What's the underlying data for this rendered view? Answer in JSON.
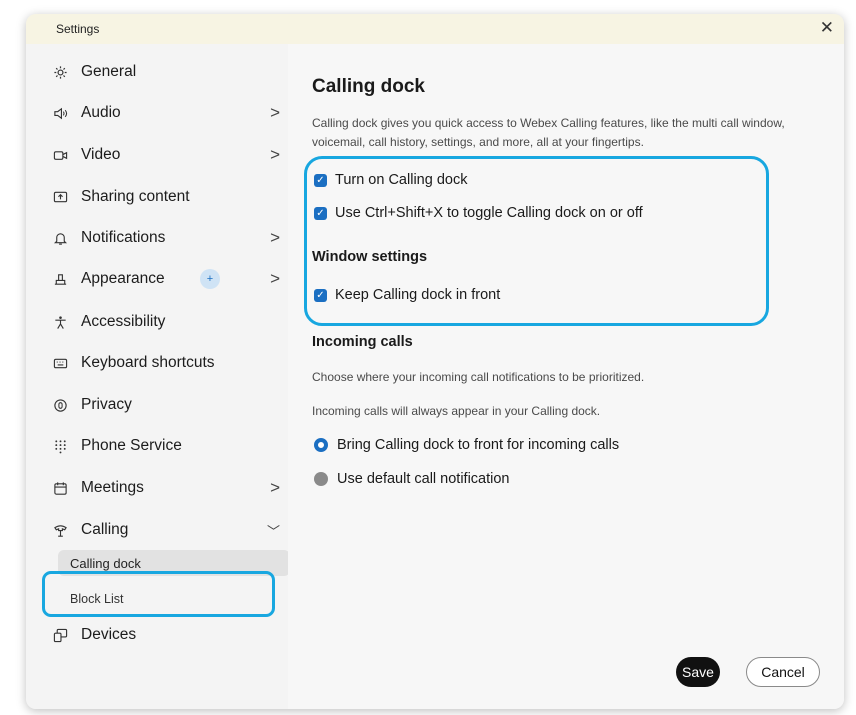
{
  "window": {
    "title": "Settings",
    "close_label": "✕"
  },
  "sidebar": {
    "items": [
      {
        "label": "General",
        "icon": "gear-icon"
      },
      {
        "label": "Audio",
        "icon": "speaker-icon",
        "chevron": ">"
      },
      {
        "label": "Video",
        "icon": "camera-icon",
        "chevron": ">"
      },
      {
        "label": "Sharing content",
        "icon": "share-screen-icon"
      },
      {
        "label": "Notifications",
        "icon": "bell-icon",
        "chevron": ">"
      },
      {
        "label": "Appearance",
        "icon": "paint-icon",
        "chevron": ">",
        "badge": "+"
      },
      {
        "label": "Accessibility",
        "icon": "accessibility-icon"
      },
      {
        "label": "Keyboard shortcuts",
        "icon": "keyboard-icon"
      },
      {
        "label": "Privacy",
        "icon": "privacy-icon"
      },
      {
        "label": "Phone Service",
        "icon": "dialpad-icon"
      },
      {
        "label": "Meetings",
        "icon": "calendar-icon",
        "chevron": ">"
      },
      {
        "label": "Calling",
        "icon": "phone-icon",
        "chevron": "﹀"
      },
      {
        "label": "Devices",
        "icon": "devices-icon"
      }
    ],
    "sub_items": [
      {
        "label": "Calling dock",
        "selected": true
      },
      {
        "label": "Block List",
        "selected": false
      }
    ]
  },
  "main": {
    "title": "Calling dock",
    "description": "Calling dock gives you quick access to Webex Calling features, like the multi call window, voicemail, call history, settings, and more, all at your fingertips.",
    "checkboxes": [
      {
        "label": "Turn on Calling dock",
        "checked": true
      },
      {
        "label": "Use Ctrl+Shift+X to toggle Calling dock on or off",
        "checked": true
      }
    ],
    "window_settings": {
      "heading": "Window settings",
      "checkbox": {
        "label": "Keep Calling dock in front",
        "checked": true
      }
    },
    "incoming_calls": {
      "heading": "Incoming calls",
      "text1": "Choose where your incoming call notifications to be prioritized.",
      "text2": "Incoming calls will always appear in your Calling dock.",
      "options": [
        {
          "label": "Bring Calling dock to front for incoming calls",
          "selected": true
        },
        {
          "label": "Use default call notification",
          "selected": false
        }
      ]
    }
  },
  "footer": {
    "save_label": "Save",
    "cancel_label": "Cancel"
  },
  "colors": {
    "accent": "#1b6fc2",
    "highlight": "#18a7e0",
    "titlebar": "#f7f4e3"
  }
}
